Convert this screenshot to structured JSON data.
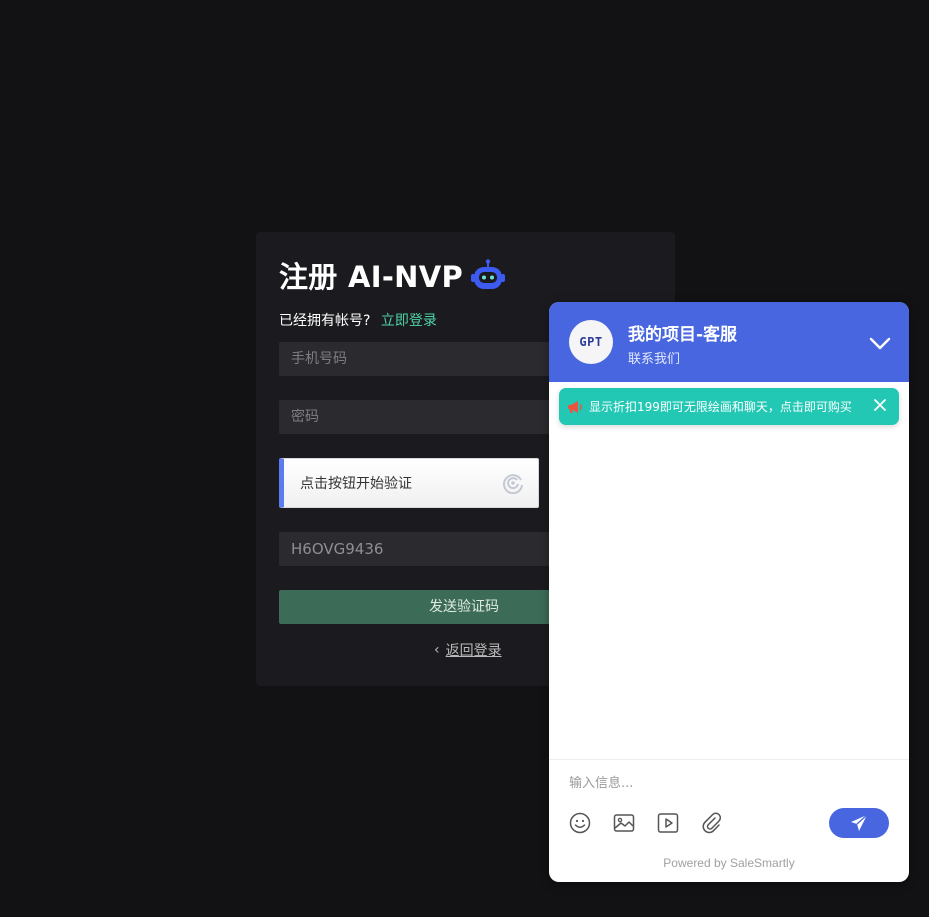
{
  "register": {
    "title": "注册 AI-NVP",
    "have_account": "已经拥有帐号?",
    "login_link": "立即登录",
    "phone_placeholder": "手机号码",
    "password_placeholder": "密码",
    "captcha_label": "点击按钮开始验证",
    "invite_code_value": "H6OVG9436",
    "send_code_button": "发送验证码",
    "back_to_login": "返回登录"
  },
  "chat": {
    "avatar_text": "GPT",
    "title": "我的项目-客服",
    "subtitle": "联系我们",
    "notice": "显示折扣199即可无限绘画和聊天，点击即可购买",
    "input_placeholder": "输入信息...",
    "powered_by": "Powered by SaleSmartly",
    "accent_color": "#4766df",
    "notice_color": "#22c8b4"
  },
  "icons": {
    "robot": "robot-icon",
    "captcha": "captcha-refresh-icon",
    "collapse": "chevron-down-icon",
    "close": "close-icon",
    "emoji": "emoji-icon",
    "image": "image-icon",
    "video": "video-icon",
    "attach": "paperclip-icon",
    "send": "send-icon",
    "horn": "megaphone-icon"
  }
}
